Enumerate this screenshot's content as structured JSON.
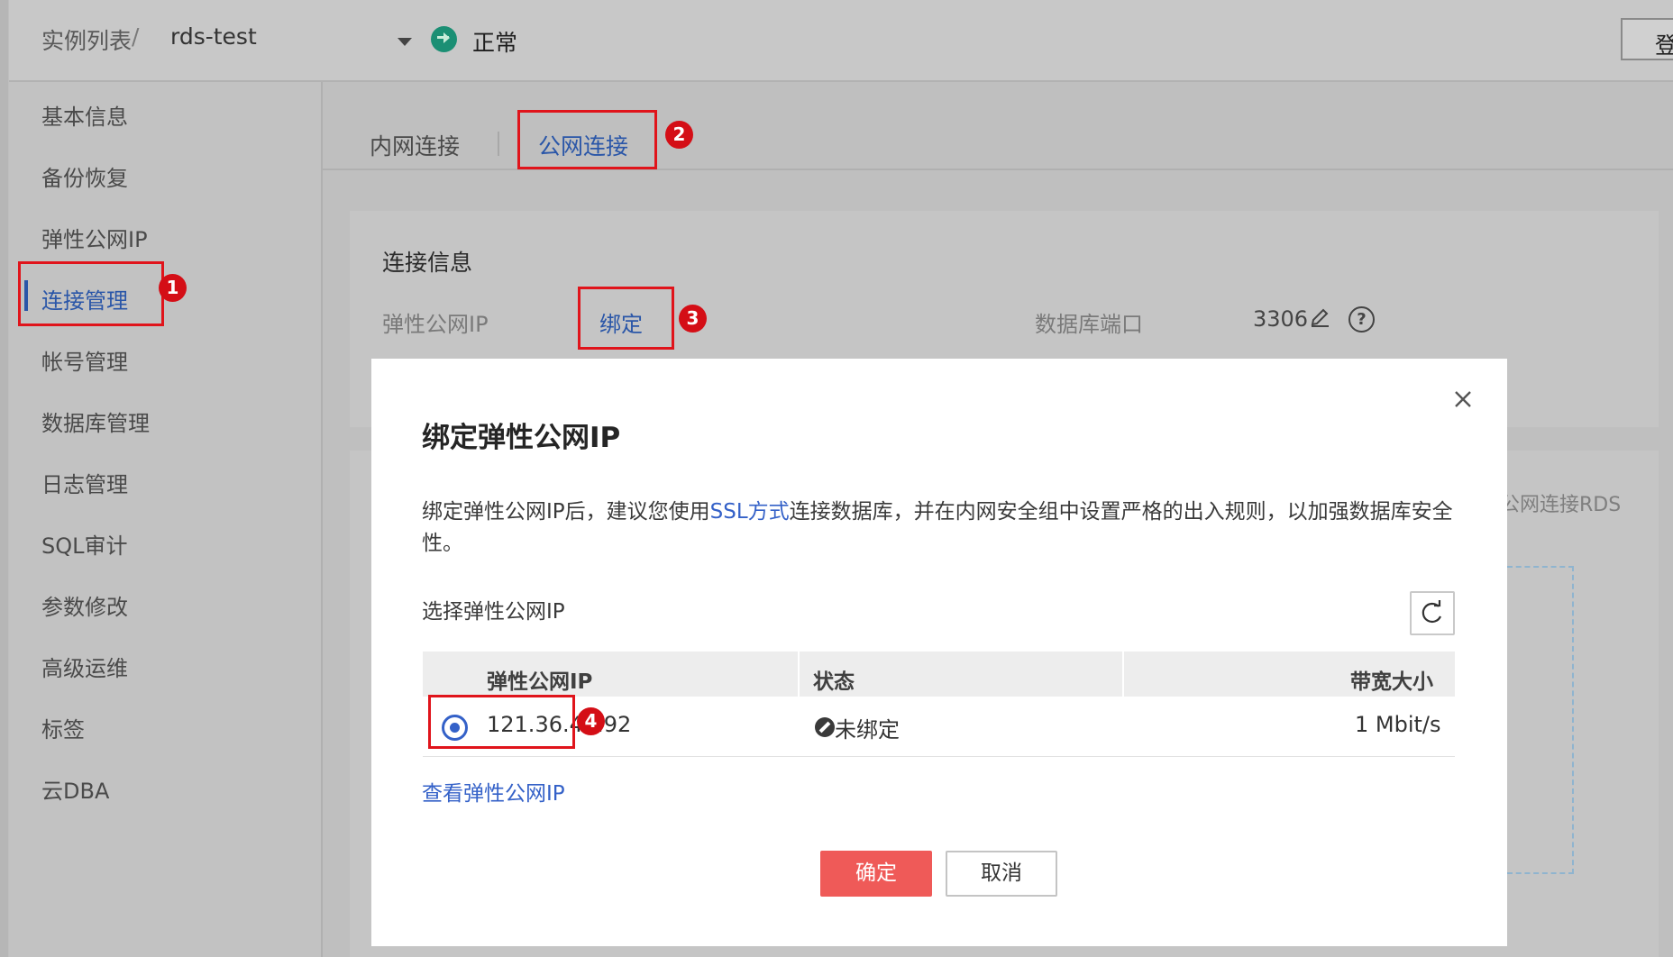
{
  "header": {
    "breadcrumb_root": "实例列表",
    "breadcrumb_sep": "/",
    "instance_name": "rds-test",
    "status": "正常",
    "right_button_label": "登"
  },
  "sidebar": {
    "items": [
      {
        "label": "基本信息"
      },
      {
        "label": "备份恢复"
      },
      {
        "label": "弹性公网IP"
      },
      {
        "label": "连接管理",
        "active": true
      },
      {
        "label": "帐号管理"
      },
      {
        "label": "数据库管理"
      },
      {
        "label": "日志管理"
      },
      {
        "label": "SQL审计"
      },
      {
        "label": "参数修改"
      },
      {
        "label": "高级运维"
      },
      {
        "label": "标签"
      },
      {
        "label": "云DBA"
      }
    ]
  },
  "tabs": [
    {
      "label": "内网连接"
    },
    {
      "label": "公网连接",
      "active": true
    }
  ],
  "connection_card": {
    "title": "连接信息",
    "eip_label": "弹性公网IP",
    "bind_link": "绑定",
    "port_label": "数据库端口",
    "port_value": "3306"
  },
  "behind_text": "公网连接RDS",
  "annotations": [
    "1",
    "2",
    "3",
    "4"
  ],
  "modal": {
    "title": "绑定弹性公网IP",
    "desc_before": "绑定弹性公网IP后，建议您使用",
    "desc_link": "SSL方式",
    "desc_after": "连接数据库，并在内网安全组中设置严格的出入规则，以加强数据库安全性。",
    "select_label": "选择弹性公网IP",
    "table": {
      "headers": [
        "弹性公网IP",
        "状态",
        "带宽大小"
      ],
      "rows": [
        {
          "ip": "121.36.46.92",
          "status": "未绑定",
          "bandwidth": "1 Mbit/s",
          "selected": true
        }
      ]
    },
    "view_link": "查看弹性公网IP",
    "ok_label": "确定",
    "cancel_label": "取消"
  },
  "colors": {
    "accent": "#3461c8",
    "primary_button": "#ef5a58",
    "annotation_red": "#e0141b",
    "status_green": "#1b8f74"
  }
}
